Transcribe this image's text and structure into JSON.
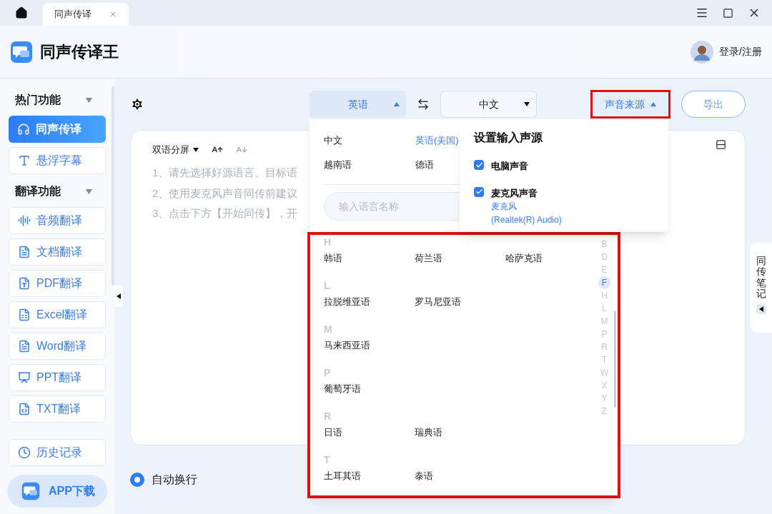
{
  "tabs": [
    {
      "label": "同声传译",
      "selected": true
    }
  ],
  "app": {
    "name": "同声传译王",
    "login": "登录/注册"
  },
  "sidebar": {
    "sections": [
      {
        "title": "热门功能",
        "expanded": true,
        "items": [
          {
            "label": "同声传译",
            "selected": true
          },
          {
            "label": "悬浮字幕",
            "selected": false
          }
        ]
      },
      {
        "title": "翻译功能",
        "expanded": true,
        "items": [
          {
            "label": "音频翻译",
            "selected": false
          },
          {
            "label": "文档翻译",
            "selected": false
          },
          {
            "label": "PDF翻译",
            "selected": false
          },
          {
            "label": "Excel翻译",
            "selected": false
          },
          {
            "label": "Word翻译",
            "selected": false
          },
          {
            "label": "PPT翻译",
            "selected": false
          },
          {
            "label": "TXT翻译",
            "selected": false
          }
        ]
      }
    ],
    "history": "历史记录",
    "app_download": "APP下载"
  },
  "toolbar": {
    "source_language": {
      "label": "英语",
      "expanded": true
    },
    "target_language": {
      "label": "中文",
      "expanded": false
    },
    "sound_source": {
      "label": "声音来源",
      "expanded": true,
      "highlighted": true
    },
    "export": "导出"
  },
  "editor": {
    "view_mode": "双语分屏",
    "hints": [
      "1、请先选择好源语言、目标语",
      "2、使用麦克风声音同传前建议",
      "3、点击下方【开始同传】，开"
    ]
  },
  "auto_wrap": {
    "label": "自动换行",
    "selected": true
  },
  "notes_tab": "同传笔记",
  "language_menu": {
    "highlighted": true,
    "popular": [
      {
        "label": "中文",
        "selected": false
      },
      {
        "label": "英语(美国)",
        "selected": true
      },
      {
        "label": "越南语",
        "selected": false
      },
      {
        "label": "德语",
        "selected": false
      }
    ],
    "search": {
      "placeholder": "输入语言名称"
    },
    "sections": [
      {
        "letter": "H",
        "languages": [
          "韩语",
          "荷兰语",
          "哈萨克语"
        ]
      },
      {
        "letter": "L",
        "languages": [
          "拉脱维亚语",
          "罗马尼亚语"
        ]
      },
      {
        "letter": "M",
        "languages": [
          "马来西亚语"
        ]
      },
      {
        "letter": "P",
        "languages": [
          "葡萄牙语"
        ]
      },
      {
        "letter": "R",
        "languages": [
          "日语",
          "瑞典语"
        ]
      },
      {
        "letter": "T",
        "languages": [
          "土耳其语",
          "泰语"
        ]
      }
    ],
    "index": [
      {
        "letter": "B",
        "selected": false
      },
      {
        "letter": "D",
        "selected": false
      },
      {
        "letter": "E",
        "selected": false
      },
      {
        "letter": "F",
        "selected": true
      },
      {
        "letter": "H",
        "selected": false
      },
      {
        "letter": "L",
        "selected": false
      },
      {
        "letter": "M",
        "selected": false
      },
      {
        "letter": "P",
        "selected": false
      },
      {
        "letter": "R",
        "selected": false
      },
      {
        "letter": "T",
        "selected": false
      },
      {
        "letter": "W",
        "selected": false
      },
      {
        "letter": "X",
        "selected": false
      },
      {
        "letter": "Y",
        "selected": false
      },
      {
        "letter": "Z",
        "selected": false
      }
    ]
  },
  "sound_menu": {
    "title": "设置输入声源",
    "sources": [
      {
        "label": "电脑声音",
        "checked": true
      },
      {
        "label": "麦克风声音",
        "checked": true,
        "details": [
          "麦克风",
          "(Realtek(R) Audio)"
        ]
      }
    ]
  }
}
